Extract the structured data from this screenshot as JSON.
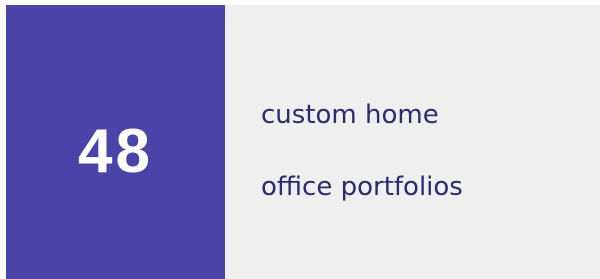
{
  "stat": {
    "number": "48",
    "caption_line1": "custom home",
    "caption_line2": "office portfolios"
  },
  "colors": {
    "stat_background": "#4a43a8",
    "text_background": "#efefef",
    "number_text": "#ffffff",
    "caption_text": "#2b2b6e"
  }
}
